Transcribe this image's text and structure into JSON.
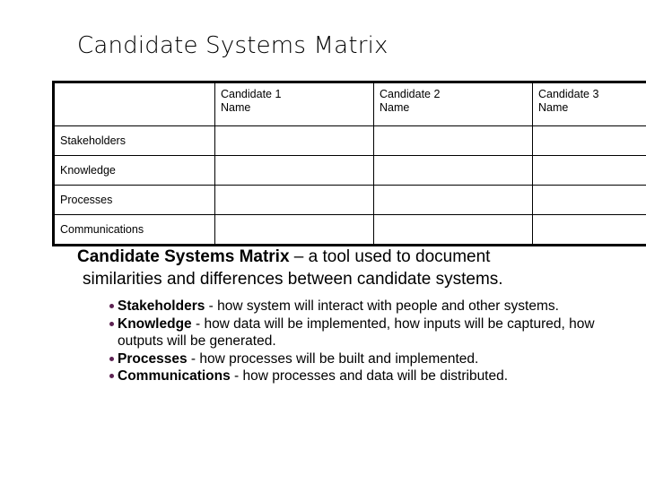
{
  "slide": {
    "title": "Candidate Systems Matrix",
    "background_color": "#ffffff",
    "text_color": "#000000"
  },
  "matrix": {
    "name": "candidate-systems-matrix",
    "corner_header": "",
    "column_headers": [
      {
        "line1": "Candidate 1",
        "line2": "Name"
      },
      {
        "line1": "Candidate 2",
        "line2": "Name"
      },
      {
        "line1": "Candidate 3",
        "line2": "Name"
      }
    ],
    "row_labels": [
      "Stakeholders",
      "Knowledge",
      "Processes",
      "Communications"
    ],
    "cells": [
      [
        "",
        "",
        ""
      ],
      [
        "",
        "",
        ""
      ],
      [
        "",
        "",
        ""
      ],
      [
        "",
        "",
        ""
      ]
    ]
  },
  "body": {
    "lead_term": "Candidate Systems Matrix",
    "lead_rest": " – a tool used to document",
    "lead_wrap": "similarities and differences between candidate systems.",
    "bullet_color": "#5C2252",
    "bullets": [
      {
        "term": "Stakeholders",
        "text": " - how system will interact with people and other systems."
      },
      {
        "term": "Knowledge",
        "text": " - how data will be implemented, how inputs will be captured, how outputs will be generated."
      },
      {
        "term": "Processes",
        "text": " - how processes will be built and implemented."
      },
      {
        "term": "Communications",
        "text": " - how processes and data will be distributed."
      }
    ]
  }
}
